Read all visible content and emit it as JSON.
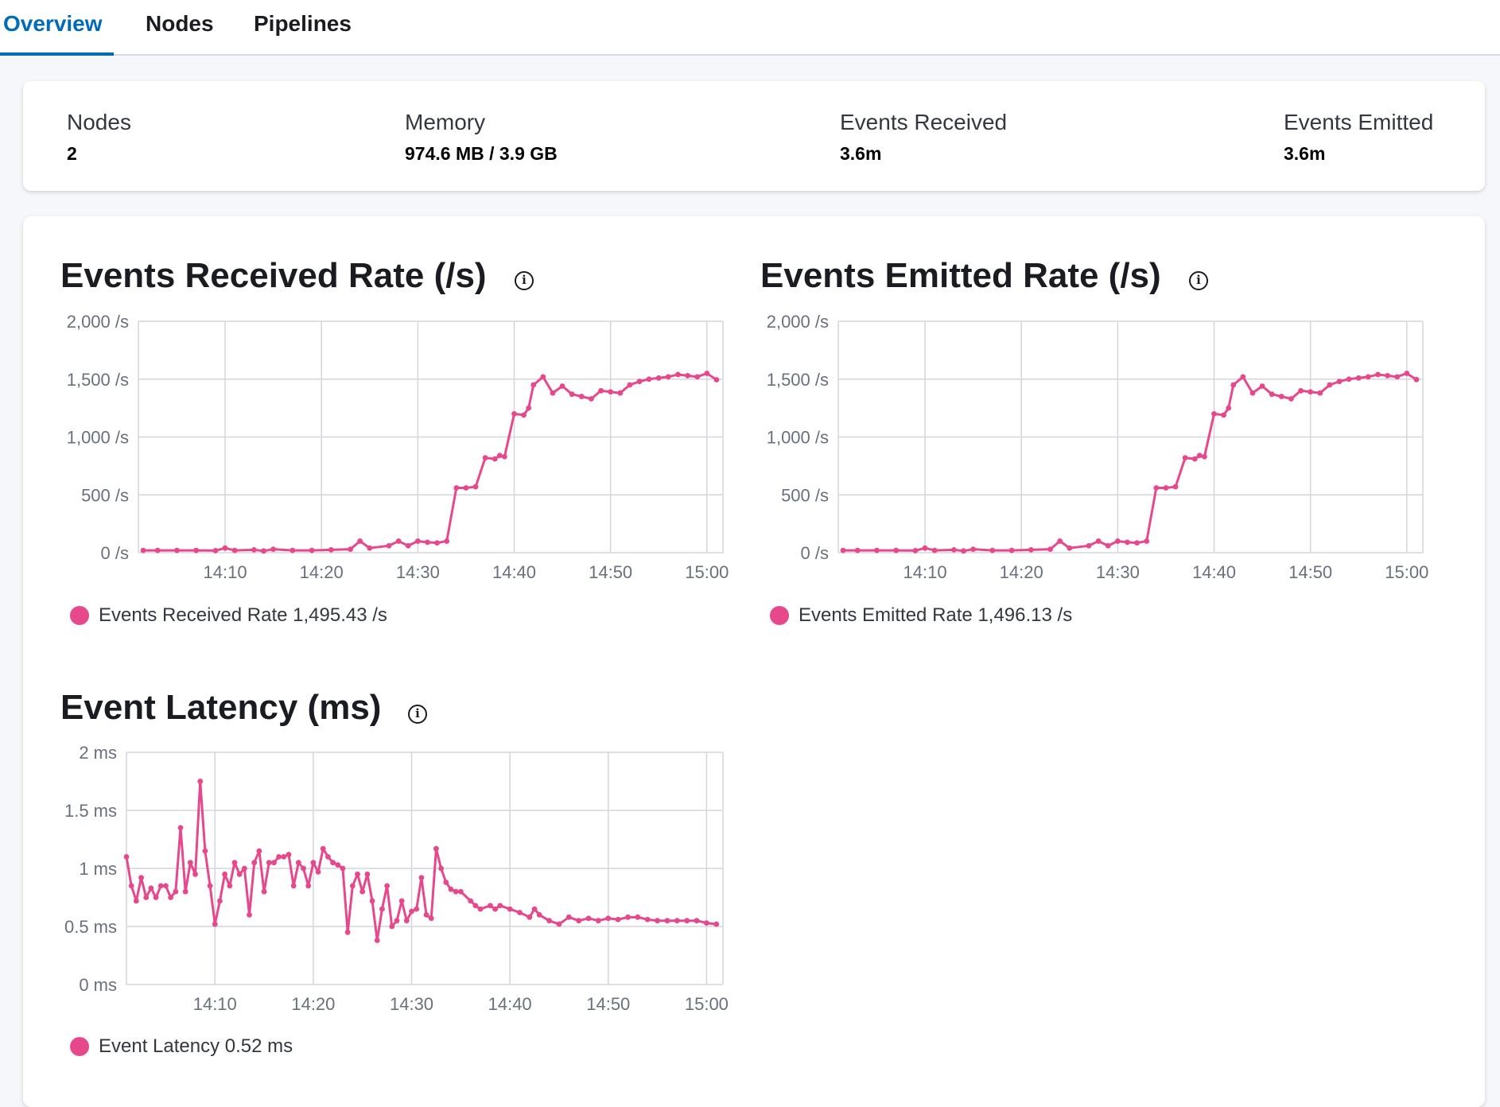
{
  "tabs": [
    {
      "label": "Overview",
      "active": true
    },
    {
      "label": "Nodes",
      "active": false
    },
    {
      "label": "Pipelines",
      "active": false
    }
  ],
  "stats": [
    {
      "title": "Nodes",
      "value": "2"
    },
    {
      "title": "Memory",
      "value": "974.6 MB / 3.9 GB"
    },
    {
      "title": "Events Received",
      "value": "3.6m"
    },
    {
      "title": "Events Emitted",
      "value": "3.6m"
    }
  ],
  "colors": {
    "series": "#e7488c",
    "accent": "#006bb8",
    "grid": "#d3d6db"
  },
  "icons": {
    "info": "info-icon",
    "legend": "legend-dot-icon"
  },
  "charts": [
    {
      "title": "Events Received Rate (/s)",
      "legend_label": "Events Received Rate",
      "legend_value": "1,495.43 /s",
      "y_ticks": [
        "2,000 /s",
        "1,500 /s",
        "1,000 /s",
        "500 /s",
        "0 /s"
      ],
      "x_ticks": [
        "14:10",
        "14:20",
        "14:30",
        "14:40",
        "14:50",
        "15:00"
      ]
    },
    {
      "title": "Events Emitted Rate (/s)",
      "legend_label": "Events Emitted Rate",
      "legend_value": "1,496.13 /s",
      "y_ticks": [
        "2,000 /s",
        "1,500 /s",
        "1,000 /s",
        "500 /s",
        "0 /s"
      ],
      "x_ticks": [
        "14:10",
        "14:20",
        "14:30",
        "14:40",
        "14:50",
        "15:00"
      ]
    },
    {
      "title": "Event Latency (ms)",
      "legend_label": "Event Latency",
      "legend_value": "0.52 ms",
      "y_ticks": [
        "2 ms",
        "1.5 ms",
        "1 ms",
        "0.5 ms",
        "0 ms"
      ],
      "x_ticks": [
        "14:10",
        "14:20",
        "14:30",
        "14:40",
        "14:50",
        "15:00"
      ]
    }
  ],
  "chart_data": [
    {
      "type": "line",
      "title": "Events Received Rate (/s)",
      "xlabel": "",
      "ylabel": "",
      "ylim": [
        0,
        2000
      ],
      "x_unit": "time (HH:MM)",
      "grid": true,
      "legend": "bottom-left",
      "series": [
        {
          "name": "Events Received Rate",
          "color": "#e7488c",
          "points": [
            [
              "14:01:30",
              20
            ],
            [
              "14:03",
              20
            ],
            [
              "14:05",
              20
            ],
            [
              "14:07",
              20
            ],
            [
              "14:09",
              18
            ],
            [
              "14:10",
              40
            ],
            [
              "14:11",
              20
            ],
            [
              "14:13",
              25
            ],
            [
              "14:14",
              15
            ],
            [
              "14:15",
              30
            ],
            [
              "14:17",
              20
            ],
            [
              "14:19",
              20
            ],
            [
              "14:21",
              25
            ],
            [
              "14:23",
              30
            ],
            [
              "14:24",
              100
            ],
            [
              "14:25",
              40
            ],
            [
              "14:27",
              60
            ],
            [
              "14:28",
              100
            ],
            [
              "14:29",
              60
            ],
            [
              "14:30",
              100
            ],
            [
              "14:31",
              90
            ],
            [
              "14:32",
              85
            ],
            [
              "14:33",
              100
            ],
            [
              "14:34",
              560
            ],
            [
              "14:35",
              560
            ],
            [
              "14:36",
              570
            ],
            [
              "14:37",
              820
            ],
            [
              "14:38",
              810
            ],
            [
              "14:38:30",
              840
            ],
            [
              "14:39",
              830
            ],
            [
              "14:40",
              1200
            ],
            [
              "14:41",
              1190
            ],
            [
              "14:41:30",
              1250
            ],
            [
              "14:42",
              1450
            ],
            [
              "14:43",
              1520
            ],
            [
              "14:44",
              1380
            ],
            [
              "14:45",
              1440
            ],
            [
              "14:46",
              1370
            ],
            [
              "14:47",
              1350
            ],
            [
              "14:48",
              1330
            ],
            [
              "14:49",
              1400
            ],
            [
              "14:50",
              1390
            ],
            [
              "14:51",
              1380
            ],
            [
              "14:52",
              1450
            ],
            [
              "14:53",
              1480
            ],
            [
              "14:54",
              1500
            ],
            [
              "14:55",
              1510
            ],
            [
              "14:56",
              1520
            ],
            [
              "14:57",
              1540
            ],
            [
              "14:58",
              1530
            ],
            [
              "14:59",
              1520
            ],
            [
              "15:00",
              1550
            ],
            [
              "15:01",
              1495
            ]
          ]
        }
      ],
      "x_ticks": [
        "14:10",
        "14:20",
        "14:30",
        "14:40",
        "14:50",
        "15:00"
      ]
    },
    {
      "type": "line",
      "title": "Events Emitted Rate (/s)",
      "xlabel": "",
      "ylabel": "",
      "ylim": [
        0,
        2000
      ],
      "x_unit": "time (HH:MM)",
      "grid": true,
      "legend": "bottom-left",
      "series": [
        {
          "name": "Events Emitted Rate",
          "color": "#e7488c",
          "points": [
            [
              "14:01:30",
              20
            ],
            [
              "14:03",
              20
            ],
            [
              "14:05",
              20
            ],
            [
              "14:07",
              20
            ],
            [
              "14:09",
              18
            ],
            [
              "14:10",
              40
            ],
            [
              "14:11",
              20
            ],
            [
              "14:13",
              25
            ],
            [
              "14:14",
              15
            ],
            [
              "14:15",
              30
            ],
            [
              "14:17",
              20
            ],
            [
              "14:19",
              20
            ],
            [
              "14:21",
              25
            ],
            [
              "14:23",
              30
            ],
            [
              "14:24",
              100
            ],
            [
              "14:25",
              40
            ],
            [
              "14:27",
              60
            ],
            [
              "14:28",
              100
            ],
            [
              "14:29",
              60
            ],
            [
              "14:30",
              100
            ],
            [
              "14:31",
              90
            ],
            [
              "14:32",
              85
            ],
            [
              "14:33",
              100
            ],
            [
              "14:34",
              560
            ],
            [
              "14:35",
              560
            ],
            [
              "14:36",
              570
            ],
            [
              "14:37",
              820
            ],
            [
              "14:38",
              810
            ],
            [
              "14:38:30",
              840
            ],
            [
              "14:39",
              830
            ],
            [
              "14:40",
              1200
            ],
            [
              "14:41",
              1190
            ],
            [
              "14:41:30",
              1250
            ],
            [
              "14:42",
              1450
            ],
            [
              "14:43",
              1520
            ],
            [
              "14:44",
              1380
            ],
            [
              "14:45",
              1440
            ],
            [
              "14:46",
              1370
            ],
            [
              "14:47",
              1350
            ],
            [
              "14:48",
              1330
            ],
            [
              "14:49",
              1400
            ],
            [
              "14:50",
              1390
            ],
            [
              "14:51",
              1380
            ],
            [
              "14:52",
              1450
            ],
            [
              "14:53",
              1480
            ],
            [
              "14:54",
              1500
            ],
            [
              "14:55",
              1510
            ],
            [
              "14:56",
              1520
            ],
            [
              "14:57",
              1540
            ],
            [
              "14:58",
              1530
            ],
            [
              "14:59",
              1520
            ],
            [
              "15:00",
              1550
            ],
            [
              "15:01",
              1496
            ]
          ]
        }
      ],
      "x_ticks": [
        "14:10",
        "14:20",
        "14:30",
        "14:40",
        "14:50",
        "15:00"
      ]
    },
    {
      "type": "line",
      "title": "Event Latency (ms)",
      "xlabel": "",
      "ylabel": "",
      "ylim": [
        0,
        2
      ],
      "x_unit": "time (HH:MM)",
      "grid": true,
      "legend": "bottom-left",
      "series": [
        {
          "name": "Event Latency",
          "color": "#e7488c",
          "points": [
            [
              "14:01",
              1.1
            ],
            [
              "14:01:30",
              0.85
            ],
            [
              "14:02",
              0.72
            ],
            [
              "14:02:30",
              0.92
            ],
            [
              "14:03",
              0.75
            ],
            [
              "14:03:30",
              0.83
            ],
            [
              "14:04",
              0.75
            ],
            [
              "14:04:30",
              0.85
            ],
            [
              "14:05",
              0.85
            ],
            [
              "14:05:30",
              0.75
            ],
            [
              "14:06",
              0.8
            ],
            [
              "14:06:30",
              1.35
            ],
            [
              "14:07",
              0.8
            ],
            [
              "14:07:30",
              1.05
            ],
            [
              "14:08",
              0.95
            ],
            [
              "14:08:30",
              1.75
            ],
            [
              "14:09",
              1.15
            ],
            [
              "14:09:30",
              0.85
            ],
            [
              "14:10",
              0.52
            ],
            [
              "14:10:30",
              0.72
            ],
            [
              "14:11",
              0.95
            ],
            [
              "14:11:30",
              0.85
            ],
            [
              "14:12",
              1.05
            ],
            [
              "14:12:30",
              0.95
            ],
            [
              "14:13",
              1.0
            ],
            [
              "14:13:30",
              0.6
            ],
            [
              "14:14",
              1.05
            ],
            [
              "14:14:30",
              1.15
            ],
            [
              "14:15",
              0.8
            ],
            [
              "14:15:30",
              1.05
            ],
            [
              "14:16",
              1.05
            ],
            [
              "14:16:30",
              1.1
            ],
            [
              "14:17",
              1.1
            ],
            [
              "14:17:30",
              1.12
            ],
            [
              "14:18",
              0.85
            ],
            [
              "14:18:30",
              1.05
            ],
            [
              "14:19",
              1.0
            ],
            [
              "14:19:30",
              0.85
            ],
            [
              "14:20",
              1.05
            ],
            [
              "14:20:30",
              0.97
            ],
            [
              "14:21",
              1.17
            ],
            [
              "14:21:30",
              1.1
            ],
            [
              "14:22",
              1.05
            ],
            [
              "14:22:30",
              1.03
            ],
            [
              "14:23",
              1.0
            ],
            [
              "14:23:30",
              0.45
            ],
            [
              "14:24",
              0.85
            ],
            [
              "14:24:30",
              0.95
            ],
            [
              "14:25",
              0.8
            ],
            [
              "14:25:30",
              0.95
            ],
            [
              "14:26",
              0.72
            ],
            [
              "14:26:30",
              0.38
            ],
            [
              "14:27",
              0.65
            ],
            [
              "14:27:30",
              0.85
            ],
            [
              "14:28",
              0.5
            ],
            [
              "14:28:30",
              0.55
            ],
            [
              "14:29",
              0.72
            ],
            [
              "14:29:30",
              0.55
            ],
            [
              "14:30",
              0.63
            ],
            [
              "14:30:30",
              0.65
            ],
            [
              "14:31",
              0.92
            ],
            [
              "14:31:30",
              0.6
            ],
            [
              "14:32",
              0.57
            ],
            [
              "14:32:30",
              1.17
            ],
            [
              "14:33",
              1.0
            ],
            [
              "14:33:30",
              0.88
            ],
            [
              "14:34",
              0.82
            ],
            [
              "14:34:30",
              0.8
            ],
            [
              "14:35",
              0.8
            ],
            [
              "14:36",
              0.72
            ],
            [
              "14:36:30",
              0.68
            ],
            [
              "14:37",
              0.65
            ],
            [
              "14:38",
              0.68
            ],
            [
              "14:38:30",
              0.65
            ],
            [
              "14:39",
              0.68
            ],
            [
              "14:40",
              0.65
            ],
            [
              "14:41",
              0.62
            ],
            [
              "14:42",
              0.58
            ],
            [
              "14:42:30",
              0.65
            ],
            [
              "14:43",
              0.6
            ],
            [
              "14:44",
              0.55
            ],
            [
              "14:45",
              0.52
            ],
            [
              "14:46",
              0.58
            ],
            [
              "14:47",
              0.55
            ],
            [
              "14:48",
              0.57
            ],
            [
              "14:49",
              0.55
            ],
            [
              "14:50",
              0.57
            ],
            [
              "14:51",
              0.56
            ],
            [
              "14:52",
              0.58
            ],
            [
              "14:53",
              0.58
            ],
            [
              "14:54",
              0.56
            ],
            [
              "14:55",
              0.55
            ],
            [
              "14:56",
              0.55
            ],
            [
              "14:57",
              0.55
            ],
            [
              "14:58",
              0.55
            ],
            [
              "14:59",
              0.55
            ],
            [
              "15:00",
              0.53
            ],
            [
              "15:01",
              0.52
            ]
          ]
        }
      ],
      "x_ticks": [
        "14:10",
        "14:20",
        "14:30",
        "14:40",
        "14:50",
        "15:00"
      ]
    }
  ]
}
